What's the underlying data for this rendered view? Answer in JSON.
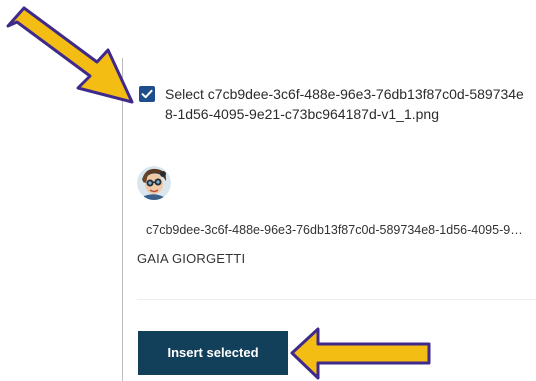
{
  "selection": {
    "checked": true,
    "label": "Select c7cb9dee-3c6f-488e-96e3-76db13f87c0d-589734e8-1d56-4095-9e21-c73bc964187d-v1_1.png"
  },
  "item": {
    "filename": "c7cb9dee-3c6f-488e-96e3-76db13f87c0d-589734e8-1d56-4095-9e21-c73bc964187d-v1_1.png",
    "author": "GAIA GIORGETTI"
  },
  "actions": {
    "insert_label": "Insert selected"
  },
  "colors": {
    "checkbox": "#1f4e8c",
    "button_bg": "#123f5a",
    "arrow_fill": "#f4bd14",
    "arrow_outline": "#3f2a8c"
  },
  "annotations": [
    {
      "icon": "arrow-annotation-icon",
      "points_to": "select-checkbox"
    },
    {
      "icon": "arrow-annotation-icon",
      "points_to": "insert-selected-button"
    }
  ]
}
